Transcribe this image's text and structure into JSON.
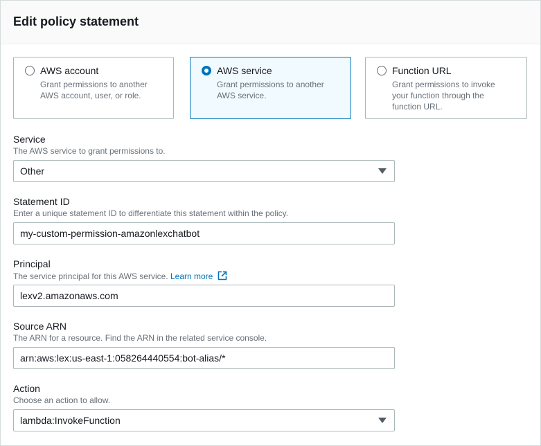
{
  "header": {
    "title": "Edit policy statement"
  },
  "tiles": [
    {
      "title": "AWS account",
      "desc": "Grant permissions to another AWS account, user, or role.",
      "selected": false
    },
    {
      "title": "AWS service",
      "desc": "Grant permissions to another AWS service.",
      "selected": true
    },
    {
      "title": "Function URL",
      "desc": "Grant permissions to invoke your function through the function URL.",
      "selected": false
    }
  ],
  "service": {
    "label": "Service",
    "desc": "The AWS service to grant permissions to.",
    "value": "Other"
  },
  "statement_id": {
    "label": "Statement ID",
    "desc": "Enter a unique statement ID to differentiate this statement within the policy.",
    "value": "my-custom-permission-amazonlexchatbot"
  },
  "principal": {
    "label": "Principal",
    "desc": "The service principal for this AWS service.",
    "link": "Learn more",
    "value": "lexv2.amazonaws.com"
  },
  "source_arn": {
    "label": "Source ARN",
    "desc": "The ARN for a resource. Find the ARN in the related service console.",
    "value": "arn:aws:lex:us-east-1:058264440554:bot-alias/*"
  },
  "action": {
    "label": "Action",
    "desc": "Choose an action to allow.",
    "value": "lambda:InvokeFunction"
  },
  "colors": {
    "accent": "#0073bb",
    "selected_bg": "#f1faff",
    "border": "#aab7b8",
    "muted": "#687078"
  }
}
